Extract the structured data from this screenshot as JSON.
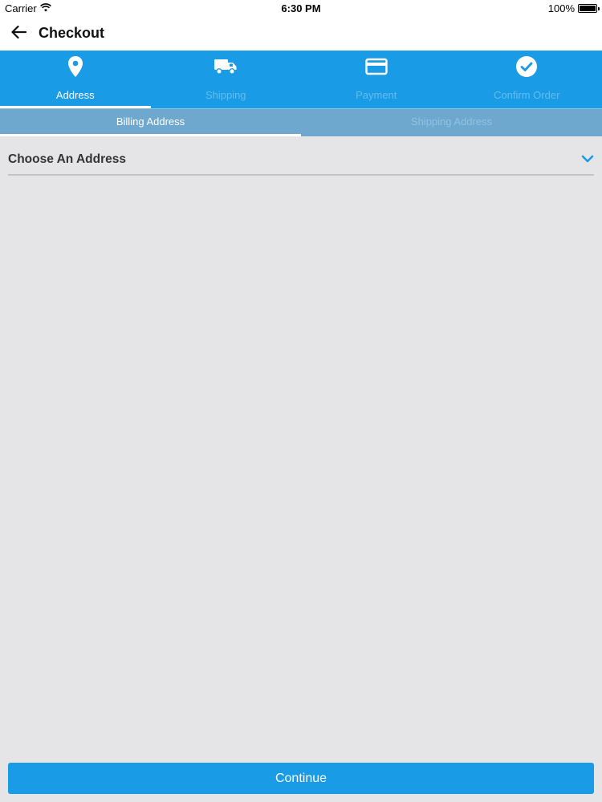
{
  "status_bar": {
    "carrier": "Carrier",
    "time": "6:30 PM",
    "battery": "100%",
    "wifi_icon": "wifi-icon",
    "battery_icon": "battery-icon"
  },
  "header": {
    "title": "Checkout",
    "back_icon": "arrow-left-icon"
  },
  "steps": [
    {
      "label": "Address",
      "icon": "map-pin-icon",
      "active": true
    },
    {
      "label": "Shipping",
      "icon": "truck-icon",
      "active": false
    },
    {
      "label": "Payment",
      "icon": "credit-card-icon",
      "active": false
    },
    {
      "label": "Confirm Order",
      "icon": "check-circle-icon",
      "active": false
    }
  ],
  "address_tabs": [
    {
      "label": "Billing Address",
      "active": true
    },
    {
      "label": "Shipping Address",
      "active": false
    }
  ],
  "address_select": {
    "value": "Choose An Address",
    "icon": "chevron-down-icon"
  },
  "footer": {
    "continue_label": "Continue"
  },
  "colors": {
    "primary": "#1a9be6",
    "subtab_bg": "#6fa8cf",
    "background": "#e5e5e8"
  }
}
